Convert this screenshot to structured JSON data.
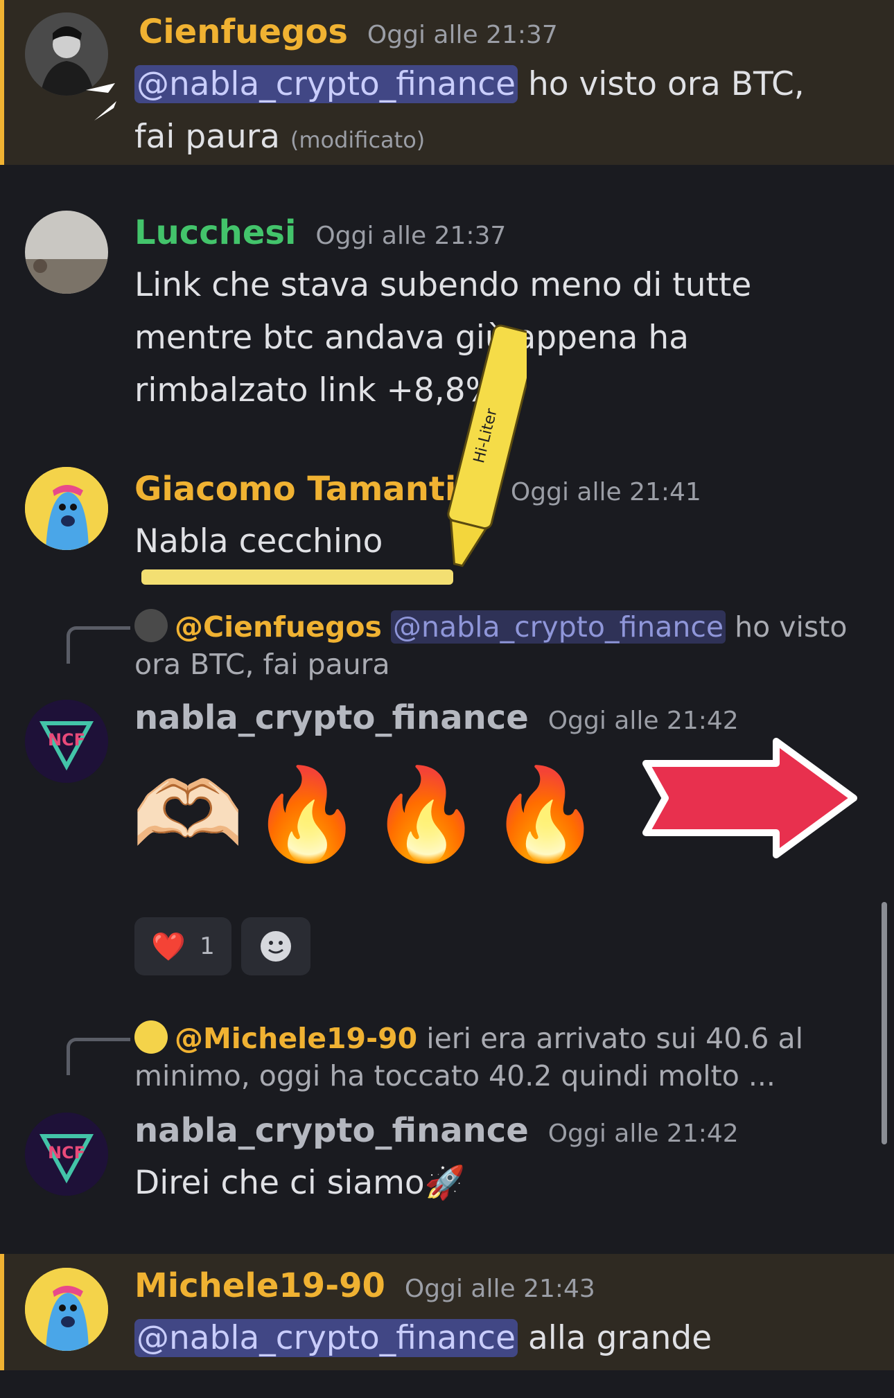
{
  "messages": [
    {
      "author": "Cienfuegos",
      "timestamp": "Oggi alle 21:37",
      "mention": "@nabla_crypto_finance",
      "text_line1": " ho visto ora BTC,",
      "text_line2": "fai paura",
      "edited": "(modificato)"
    },
    {
      "author": "Lucchesi",
      "timestamp": "Oggi alle 21:37",
      "lines": [
        "Link che stava subendo meno di tutte",
        "mentre btc andava giù appena ha",
        "rimbalzato link +8,8%"
      ]
    },
    {
      "author": "Giacomo Tamantini",
      "timestamp": "Oggi alle 21:41",
      "text": "Nabla cecchino"
    },
    {
      "reply": {
        "author": "@Cienfuegos",
        "mention": "@nabla_crypto_finance",
        "text": " ho visto ora BTC, fai paura"
      },
      "author": "nabla_crypto_finance",
      "timestamp": "Oggi alle 21:42",
      "emoji": "🫶🏻🔥🔥🔥",
      "reactions": [
        {
          "emoji": "❤️",
          "count": "1"
        }
      ]
    },
    {
      "reply": {
        "author": "@Michele19-90",
        "text_line1": " ieri era arrivato sui 40.6 al",
        "text_line2": "minimo, oggi ha toccato 40.2 quindi molto ..."
      },
      "author": "nabla_crypto_finance",
      "timestamp": "Oggi alle 21:42",
      "text": "Direi che ci siamo🚀"
    },
    {
      "author": "Michele19-90",
      "timestamp": "Oggi alle 21:43",
      "mention": "@nabla_crypto_finance",
      "text": " alla grande"
    }
  ],
  "colors": {
    "background": "#1a1b20",
    "mention_bg": "#2f2a22",
    "mention_border": "#f0b232",
    "name_cienfuegos": "#f0b232",
    "name_lucchesi": "#43c46b",
    "name_giacomo": "#f0b232",
    "name_nabla": "#b5b8c0",
    "name_michele": "#f0b232"
  },
  "icons": {
    "add_reaction": "smile-icon",
    "highlighter": "highlighter-marker-icon",
    "arrow": "red-arrow-right-icon"
  },
  "marker_label": "Hi-Liter"
}
